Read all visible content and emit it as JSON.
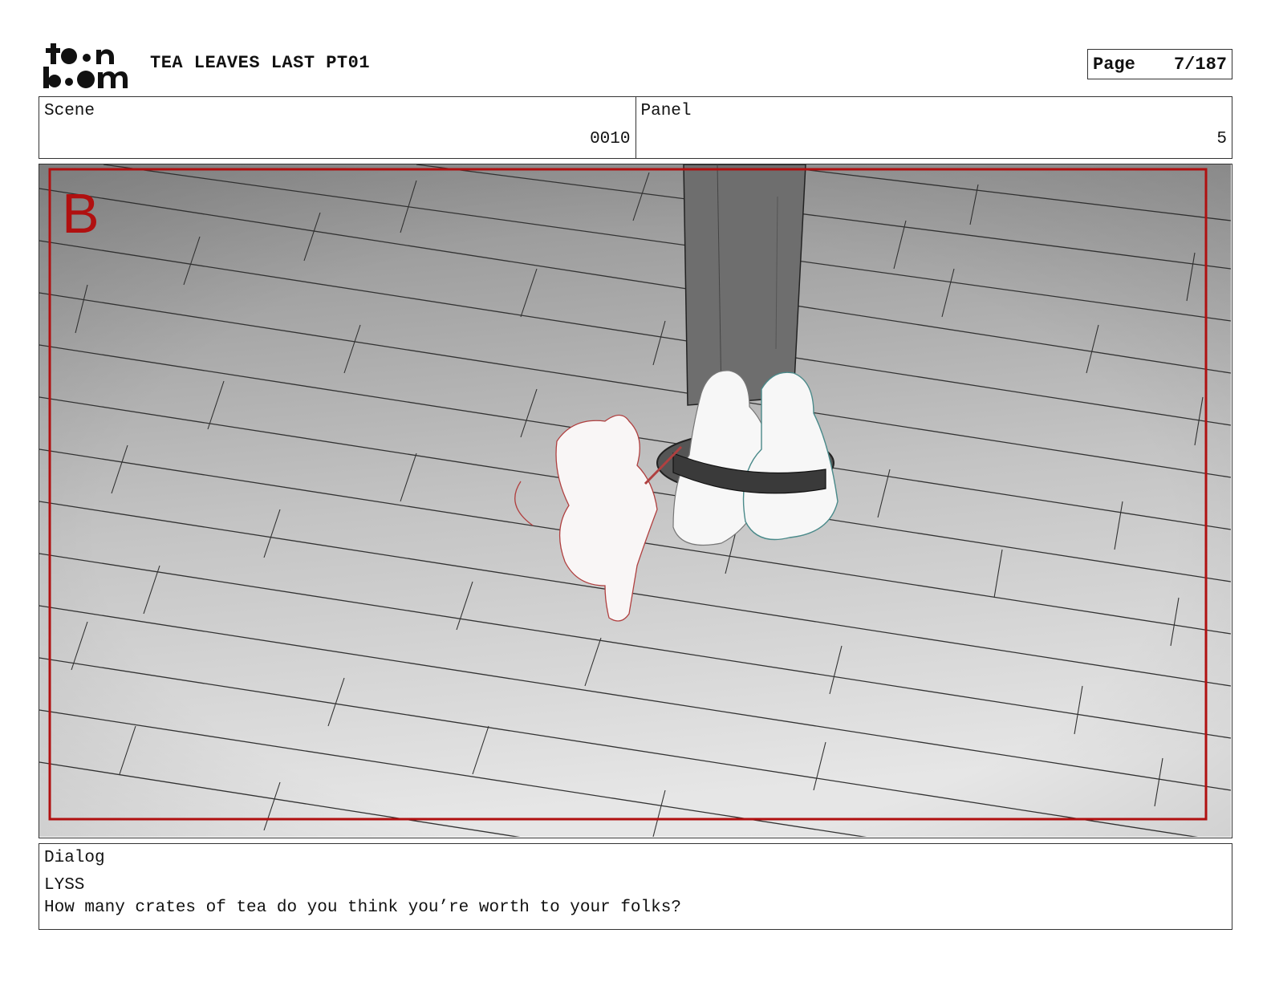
{
  "header": {
    "logo_text": "toon boom",
    "title": "TEA LEAVES LAST PT01",
    "page_label": "Page",
    "page_value": "7/187"
  },
  "info": {
    "scene_label": "Scene",
    "scene_value": "0010",
    "panel_label": "Panel",
    "panel_value": "5"
  },
  "frame": {
    "marker": "B",
    "marker_color": "#b01010",
    "border_color": "#b01010"
  },
  "dialog": {
    "label": "Dialog",
    "speaker": "LYSS",
    "text": "How many crates of tea do you think you’re worth to your folks?"
  }
}
